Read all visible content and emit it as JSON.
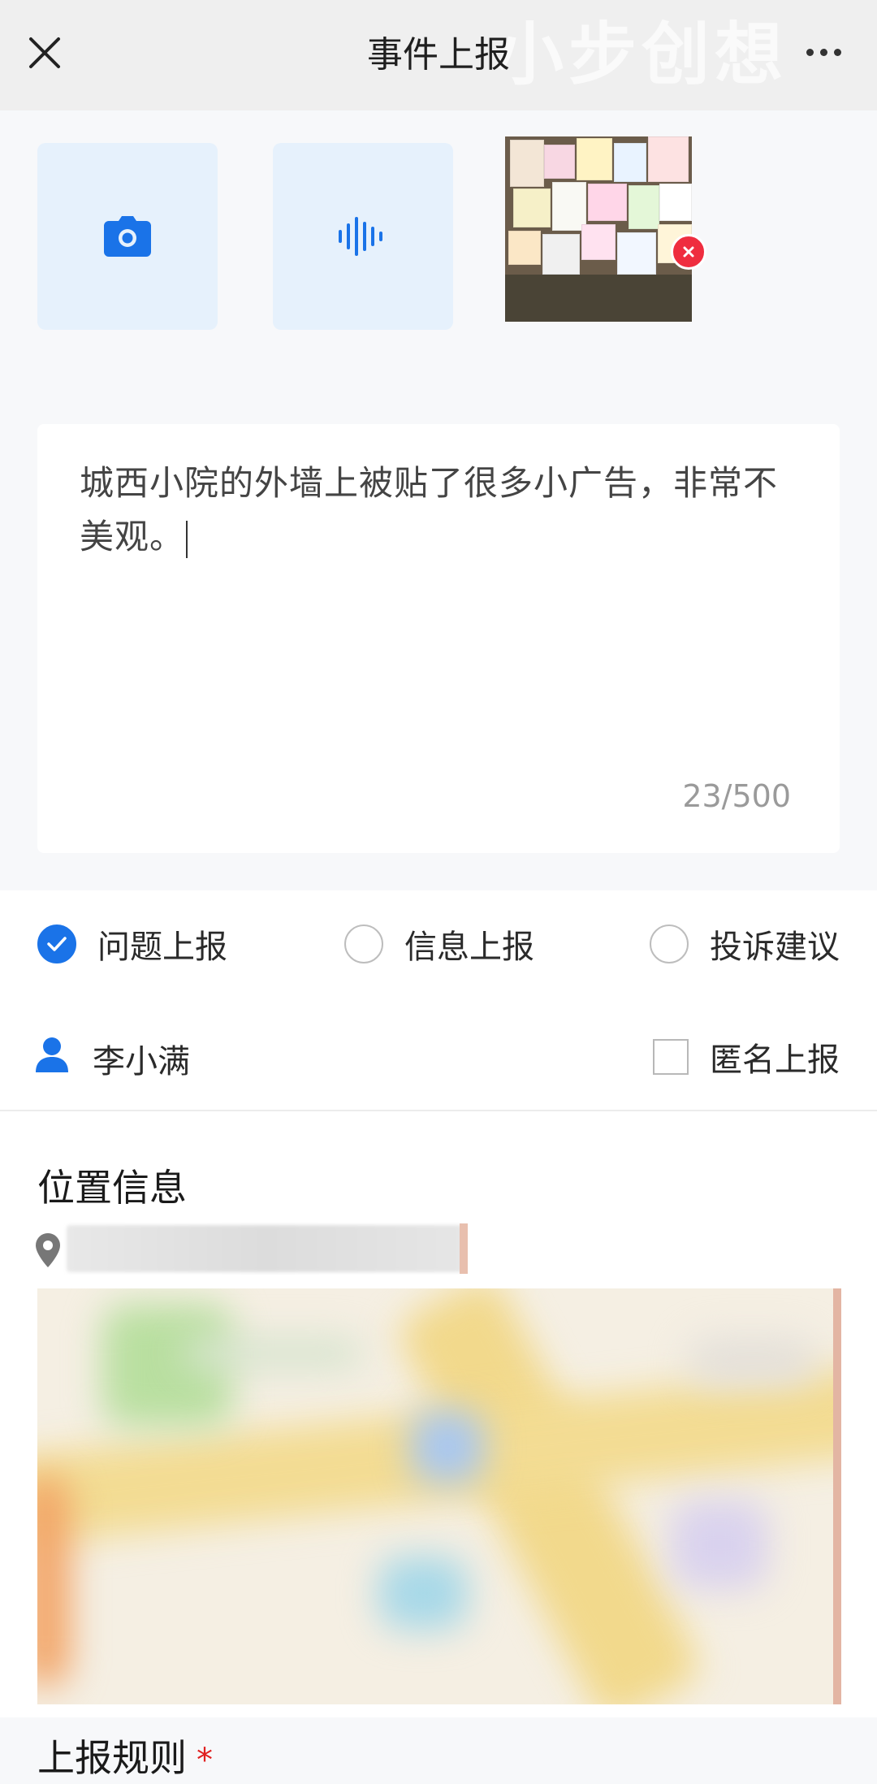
{
  "header": {
    "title": "事件上报",
    "watermark": "小步创想"
  },
  "media": {
    "camera_icon": "camera-icon",
    "voice_icon": "voice-wave-icon",
    "photo_count": 1
  },
  "description": {
    "text": "城西小院的外墙上被贴了很多小广告，非常不美观。",
    "counter": "23/500"
  },
  "report_types": {
    "options": [
      {
        "label": "问题上报",
        "checked": true
      },
      {
        "label": "信息上报",
        "checked": false
      },
      {
        "label": "投诉建议",
        "checked": false
      }
    ]
  },
  "reporter": {
    "name": "李小满",
    "anonymous_label": "匿名上报",
    "anonymous_checked": false
  },
  "location": {
    "title": "位置信息"
  },
  "rules": {
    "title": "上报规则",
    "required_mark": "*"
  },
  "colors": {
    "accent": "#1a73e8",
    "danger": "#ef2d3f",
    "tile_bg": "#e6f1fc"
  }
}
